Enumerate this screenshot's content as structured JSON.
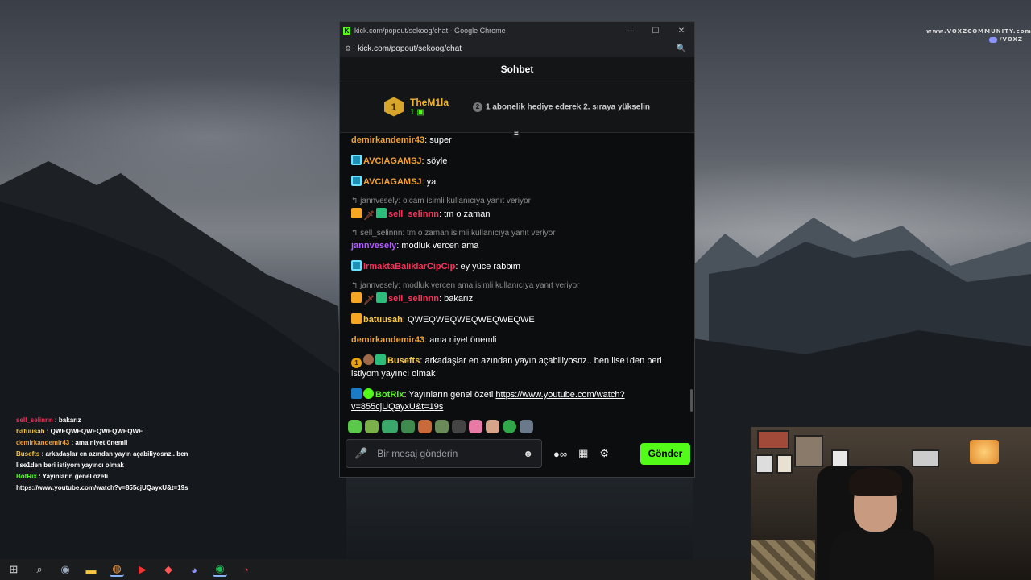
{
  "overlay_brand": {
    "line1": "www.VOXZCOMMUNITY.com",
    "line2": "/VOXZ"
  },
  "window": {
    "title": "kick.com/popout/sekoog/chat - Google Chrome",
    "url": "kick.com/popout/sekoog/chat",
    "controls": [
      "—",
      "☐",
      "✕"
    ]
  },
  "chat": {
    "header": "Sohbet",
    "pinned": {
      "rank": "1",
      "name": "TheM1la",
      "count": "1",
      "rank2": "2",
      "message": "1 abonelik hediye ederek 2. sıraya yükselin"
    },
    "messages": [
      {
        "user": "demirkandemir43",
        "text": "super"
      },
      {
        "user": "AVCIAGAMSJ",
        "text": "söyle"
      },
      {
        "user": "AVCIAGAMSJ",
        "text": "ya"
      },
      {
        "reply": "jannvesely: olcam isimli kullanıcıya yanıt veriyor",
        "user": "sell_selinnn",
        "text": "tm o zaman"
      },
      {
        "reply": "sell_selinnn: tm o zaman isimli kullanıcıya yanıt veriyor",
        "user": "jannvesely",
        "text": "modluk vercen ama"
      },
      {
        "user": "IrmaktaBaliklarCipCip",
        "text": "ey yüce rabbim"
      },
      {
        "reply": "jannvesely: modluk vercen ama isimli kullanıcıya yanıt veriyor",
        "user": "sell_selinnn",
        "text": "bakarız"
      },
      {
        "user": "batuusah",
        "text": "QWEQWEQWEQWEQWEQWE"
      },
      {
        "user": "demirkandemir43",
        "text": "ama niyet önemli"
      },
      {
        "user": "Busefts",
        "text": "arkadaşlar en azından yayın açabiliyosnz.. ben lise1den beri istiyom yayıncı olmak"
      },
      {
        "user": "BotRix",
        "text": "Yayınların genel özeti ",
        "link": "https://www.youtube.com/watch?v=855cjUQayxU&t=19s"
      }
    ],
    "input_placeholder": "Bir mesaj gönderin",
    "send_label": "Gönder"
  },
  "overlay_chat": [
    {
      "user": "sell_selinnn",
      "text": " : bakarız"
    },
    {
      "user": "batuusah",
      "text": " : QWEQWEQWEQWEQWEQWE"
    },
    {
      "user": "demirkandemir43",
      "text": " : ama niyet önemli"
    },
    {
      "user": "Busefts",
      "text": " : arkadaşlar en azından yayın açabiliyosnz.. ben",
      "cont": "lise1den beri istiyom yayıncı olmak"
    },
    {
      "user": "BotRix",
      "text": " : Yayınların genel özeti",
      "cont": "https://www.youtube.com/watch?v=855cjUQayxU&t=19s"
    }
  ],
  "colors": {
    "kick_green": "#53fc18",
    "orange_user": "#f0a136",
    "cyan_user": "#3fd0ff",
    "red_user": "#ff2f5b",
    "purple_user": "#b15cff",
    "yellow_user": "#f7c948"
  },
  "icons": [
    "windows-icon",
    "search-icon",
    "steam-icon",
    "file-explorer-icon",
    "chrome-icon",
    "media-icon",
    "brave-icon",
    "discord-icon",
    "spotify-icon",
    "speedometer-icon"
  ]
}
